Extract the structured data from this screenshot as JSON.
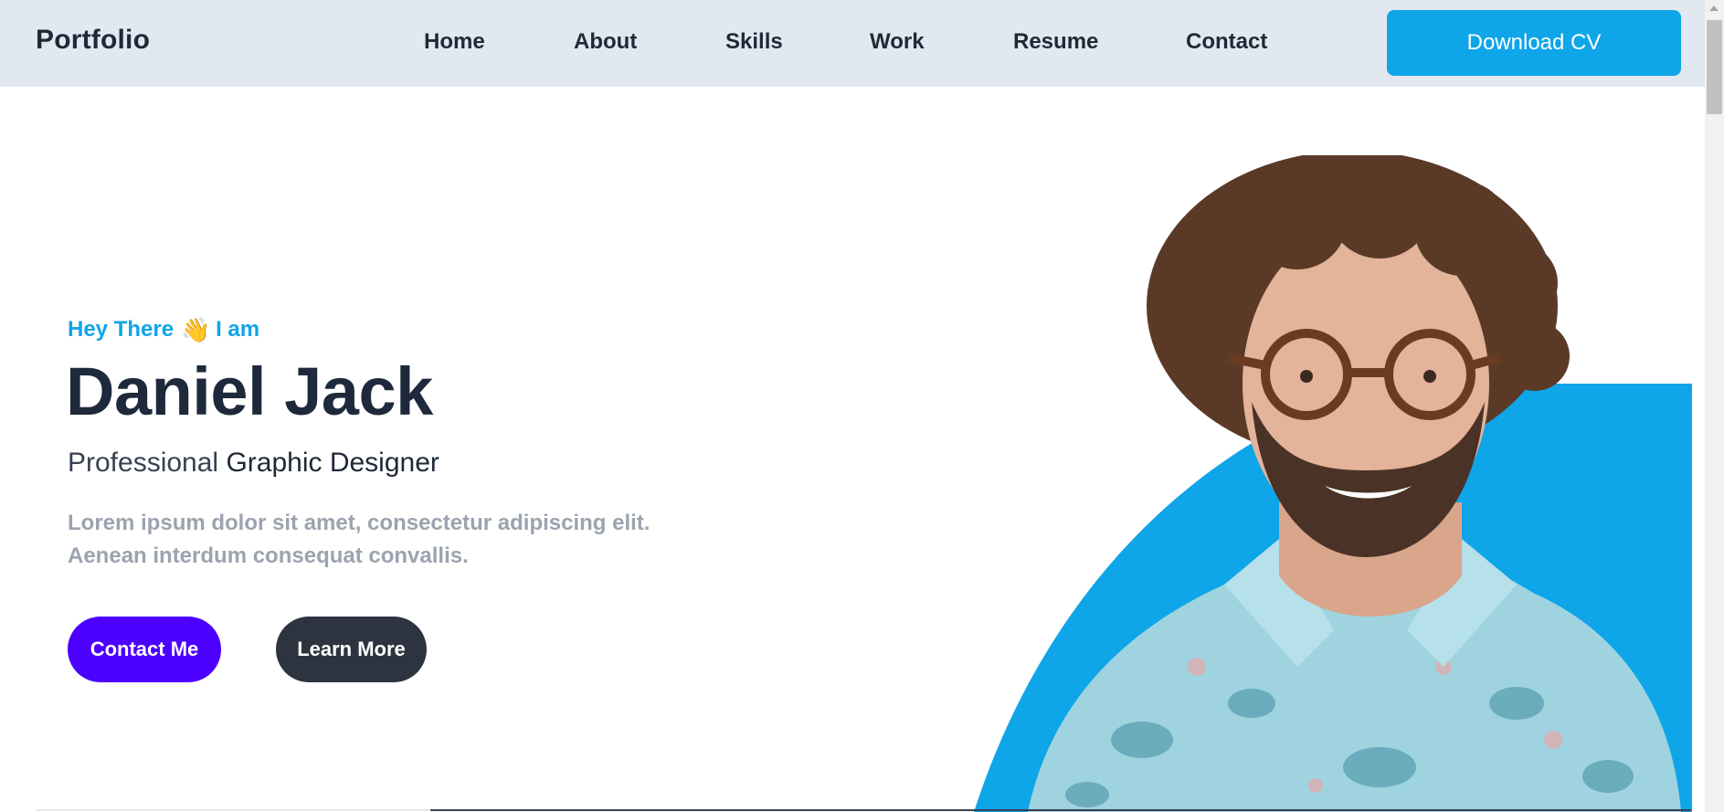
{
  "header": {
    "brand": "Portfolio",
    "nav": [
      "Home",
      "About",
      "Skills",
      "Work",
      "Resume",
      "Contact"
    ],
    "cta": "Download CV"
  },
  "hero": {
    "greeting_prefix": "Hey There",
    "greeting_icon": "waving-hand-icon",
    "greeting_suffix": "I am",
    "name": "Daniel Jack",
    "role_light": "Professional",
    "role_strong": "Graphic Designer",
    "description_line1": "Lorem ipsum dolor sit amet, consectetur adipiscing elit.",
    "description_line2": "Aenean interdum consequat convallis.",
    "primary_button": "Contact Me",
    "secondary_button": "Learn More"
  },
  "colors": {
    "accent": "#0ea5e9",
    "primary_button": "#4c00ff",
    "secondary_button": "#2d3440",
    "header_bg": "#e2e8f0",
    "heading": "#1e293b",
    "muted_text": "#9ca3af"
  }
}
